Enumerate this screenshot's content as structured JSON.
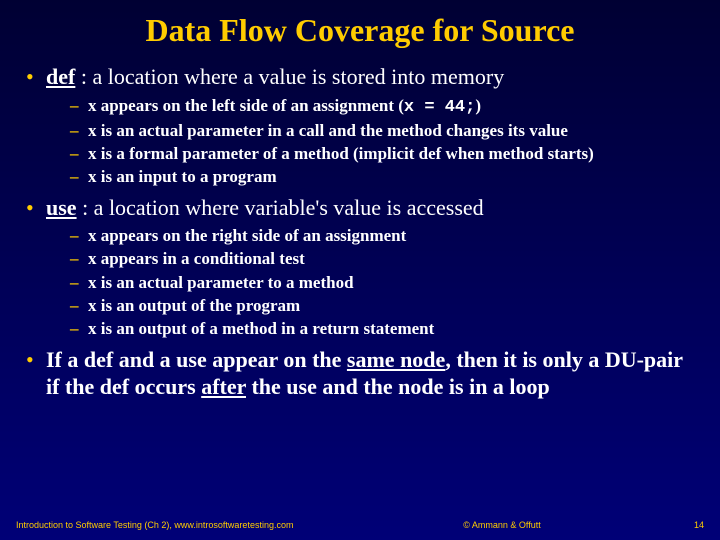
{
  "title": "Data Flow Coverage for Source",
  "bullets": [
    {
      "term": "def",
      "rest": " : a location where a value is stored into memory",
      "subs": [
        {
          "pre": "x appears on the left side of an assignment (",
          "code": "x = 44;",
          "post": ")"
        },
        {
          "pre": "x is an actual parameter in a call and the method changes its value",
          "code": "",
          "post": ""
        },
        {
          "pre": "x is a formal parameter of a method (implicit def when method starts)",
          "code": "",
          "post": ""
        },
        {
          "pre": "x is an input to a program",
          "code": "",
          "post": ""
        }
      ]
    },
    {
      "term": "use",
      "rest": " : a location where variable's value is accessed",
      "subs": [
        {
          "pre": "x appears on the right side of an assignment",
          "code": "",
          "post": ""
        },
        {
          "pre": "x appears in a conditional test",
          "code": "",
          "post": ""
        },
        {
          "pre": "x is an actual parameter to a method",
          "code": "",
          "post": ""
        },
        {
          "pre": "x is an output of the program",
          "code": "",
          "post": ""
        },
        {
          "pre": "x is an output of a method in a return statement",
          "code": "",
          "post": ""
        }
      ]
    }
  ],
  "last_bullet": {
    "p1": "If a def and a use appear on the ",
    "u1": "same node",
    "p2": ", then it is only a DU-pair if the def occurs ",
    "u2": "after",
    "p3": " the use and the node is in a loop"
  },
  "footer": {
    "left": "Introduction to Software Testing (Ch 2), www.introsoftwaretesting.com",
    "center": "© Ammann & Offutt",
    "right": "14"
  }
}
